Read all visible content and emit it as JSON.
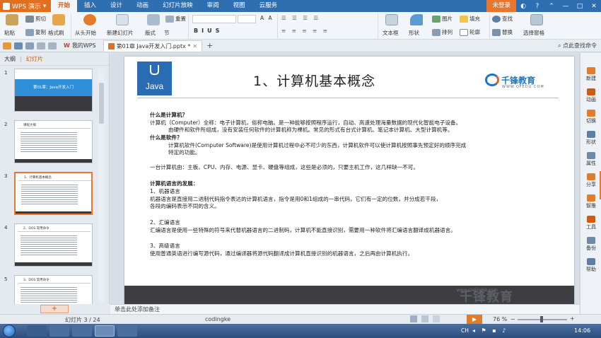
{
  "app": {
    "name": "WPS 演示"
  },
  "menu": [
    "开始",
    "插入",
    "设计",
    "动画",
    "幻灯片放映",
    "审阅",
    "视图",
    "云服务"
  ],
  "menu_active": 0,
  "login": "未登录",
  "ribbon": {
    "paste": "粘贴",
    "cut": "剪切",
    "copy": "复制",
    "format_painter": "格式刷",
    "from_start": "从头开始",
    "new_slide": "新建幻灯片",
    "layout": "版式",
    "section": "节",
    "reset": "重置",
    "textbox": "文本框",
    "shape": "形状",
    "arrange": "排列",
    "picture": "图片",
    "fill": "填充",
    "outline": "轮廓",
    "find": "查找",
    "replace": "替换",
    "select_pane": "选择窗格"
  },
  "tabs": {
    "mywps": "我的WPS",
    "doc": "第01章 Java开发入门.pptx *",
    "search": "点此查找命令"
  },
  "leftpanel": {
    "tab_outline": "大纲",
    "tab_slides": "幻灯片",
    "thumbs": [
      {
        "num": "1",
        "title": "第01章：Java开发入门"
      },
      {
        "num": "2",
        "title": "课程大纲"
      },
      {
        "num": "3",
        "title": "1、计算机基本概念"
      },
      {
        "num": "4",
        "title": "2、DOS 常用命令"
      },
      {
        "num": "5",
        "title": "3、DOS 常用命令"
      }
    ],
    "add": "+"
  },
  "slide": {
    "logo_text": "Java",
    "title": "1、计算机基本概念",
    "brand": "千锋教育",
    "brand_url": "WWW.QFEDU.COM",
    "lines": [
      "什么是计算机？",
      "计算机（Computer）全称：电子计算机，俗称电脑。是一种能够按照程序运行，自动、高速处理海量数据的现代化智能电子设备。",
      "由硬件和软件所组成，没有安装任何软件的计算机称为裸机。常见的形式有台式计算机、笔记本计算机、大型计算机等。",
      "什么是软件？",
      "计算机软件(Computer Software)是使用计算机过程中必不可少的东西，计算机软件可以使计算机按照事先预定好的顺序完成",
      "特定的功能。",
      "一台计算机由：主板、CPU、内存、电源、显卡、硬盘等组成，这些是必须的，只要主机工作，这几样缺一不可。",
      "计算机语言的发展：",
      "1、机器语言",
      "机器语言是直接用二进制代码指令表达的计算机语言，指令是用0和1组成的一串代码，它们有一定的位数，并分成若干段，",
      "各段的编码表示不同的含义。",
      "2、汇编语言",
      "汇编语言是使用一些特殊的符号来代替机器语言的二进制码，计算机不能直接识别，需要用一种软件将汇编语言翻译成机器语言。",
      "3、高级语言",
      "使用普通英语进行编写源代码，通过编译器将源代码翻译成计算机直接识别的机器语言，之后再由计算机执行。"
    ],
    "footer_url": "www.codingke.com",
    "footer_wm": "千锋教育"
  },
  "rightstrip": [
    "新建",
    "动画",
    "切换",
    "形状",
    "属性",
    "分享",
    "智推",
    "工具",
    "备份",
    "帮助"
  ],
  "notes": "单击此处添加备注",
  "status": {
    "slide_info": "幻灯片 3 / 24",
    "theme": "codingke",
    "zoom": "76 %"
  },
  "taskbar": {
    "lang": "CH",
    "time": "14:06"
  },
  "colors": {
    "menubar": "#2d6fb0",
    "accent": "#e0701d",
    "java_blue": "#2a6cb4",
    "brand_blue": "#1e76c0"
  }
}
